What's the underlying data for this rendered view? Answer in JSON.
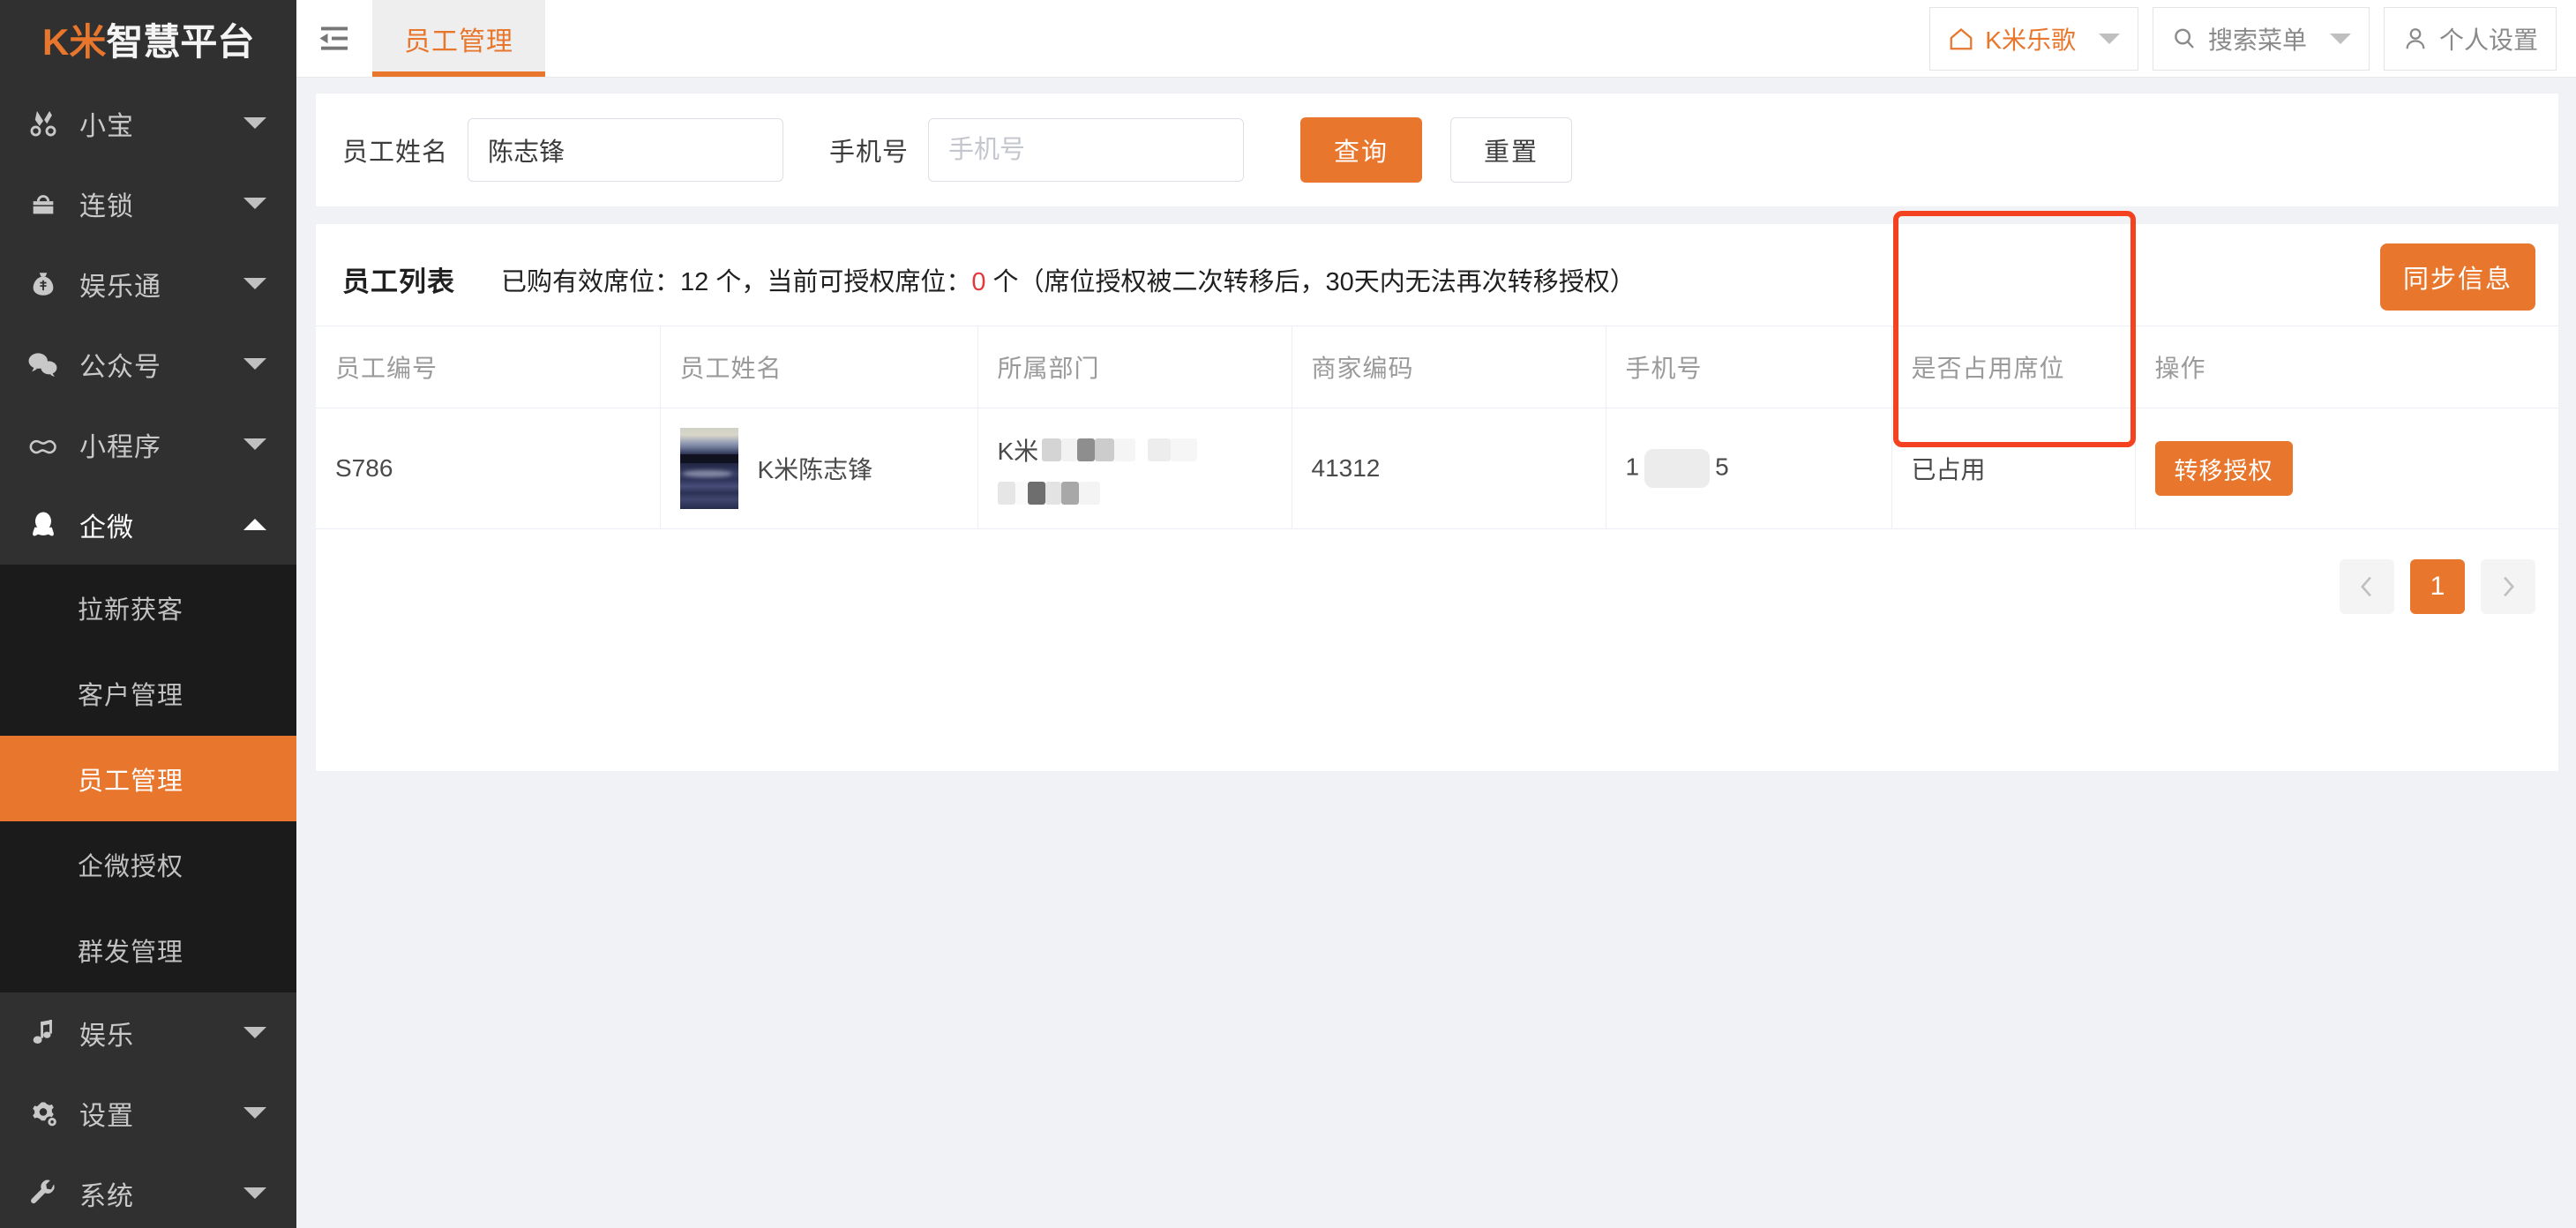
{
  "brand": {
    "logo_primary": "K米",
    "logo_secondary": "智慧平台",
    "accent_color": "#e8762c"
  },
  "sidebar": {
    "items": [
      {
        "label": "小宝",
        "icon": "scissors-icon",
        "expandable": true,
        "expanded": false
      },
      {
        "label": "连锁",
        "icon": "bag-icon",
        "expandable": true,
        "expanded": false
      },
      {
        "label": "娱乐通",
        "icon": "moneybag-icon",
        "expandable": true,
        "expanded": false
      },
      {
        "label": "公众号",
        "icon": "wechat-icon",
        "expandable": true,
        "expanded": false
      },
      {
        "label": "小程序",
        "icon": "cloud-icon",
        "expandable": true,
        "expanded": false
      },
      {
        "label": "企微",
        "icon": "qq-penguin-icon",
        "expandable": true,
        "expanded": true
      },
      {
        "label": "娱乐",
        "icon": "music-note-icon",
        "expandable": true,
        "expanded": false
      },
      {
        "label": "设置",
        "icon": "gears-icon",
        "expandable": true,
        "expanded": false
      },
      {
        "label": "系统",
        "icon": "wrench-icon",
        "expandable": true,
        "expanded": false
      }
    ],
    "submenu": [
      {
        "label": "拉新获客",
        "active": false
      },
      {
        "label": "客户管理",
        "active": false
      },
      {
        "label": "员工管理",
        "active": true
      },
      {
        "label": "企微授权",
        "active": false
      },
      {
        "label": "群发管理",
        "active": false
      }
    ]
  },
  "topbar": {
    "collapse_icon": "collapse-menu-icon",
    "tabs": [
      {
        "label": "员工管理",
        "active": true
      }
    ],
    "buttons": [
      {
        "label": "K米乐歌",
        "icon": "home-icon",
        "has_dropdown": true,
        "accent": true
      },
      {
        "label": "搜索菜单",
        "icon": "search-icon",
        "has_dropdown": true,
        "accent": false
      },
      {
        "label": "个人设置",
        "icon": "user-icon",
        "has_dropdown": false,
        "accent": false
      }
    ]
  },
  "filter": {
    "name_label": "员工姓名",
    "name_value": "陈志锋",
    "name_placeholder": "员工姓名",
    "phone_label": "手机号",
    "phone_value": "",
    "phone_placeholder": "手机号",
    "query_label": "查询",
    "reset_label": "重置"
  },
  "list": {
    "title": "员工列表",
    "note_prefix": "已购有效席位：12 个，当前可授权席位：",
    "note_count": "0",
    "note_suffix": " 个（席位授权被二次转移后，30天内无法再次转移授权）",
    "sync_label": "同步信息",
    "columns": [
      "员工编号",
      "员工姓名",
      "所属部门",
      "商家编码",
      "手机号",
      "是否占用席位",
      "操作"
    ],
    "rows": [
      {
        "emp_no": "S786",
        "emp_name": "K米陈志锋",
        "avatar": "landscape-photo-avatar",
        "dept_prefix": "K米",
        "dept_redacted": true,
        "merchant_code": "41312",
        "phone_prefix": "1",
        "phone_suffix": "5",
        "phone_redacted": true,
        "seat_status": "已占用",
        "action_label": "转移授权"
      }
    ]
  },
  "pagination": {
    "prev_icon": "chevron-left-icon",
    "next_icon": "chevron-right-icon",
    "pages": [
      "1"
    ],
    "current": "1"
  },
  "annotation": {
    "color": "#f4411f",
    "target": "是否占用席位"
  }
}
